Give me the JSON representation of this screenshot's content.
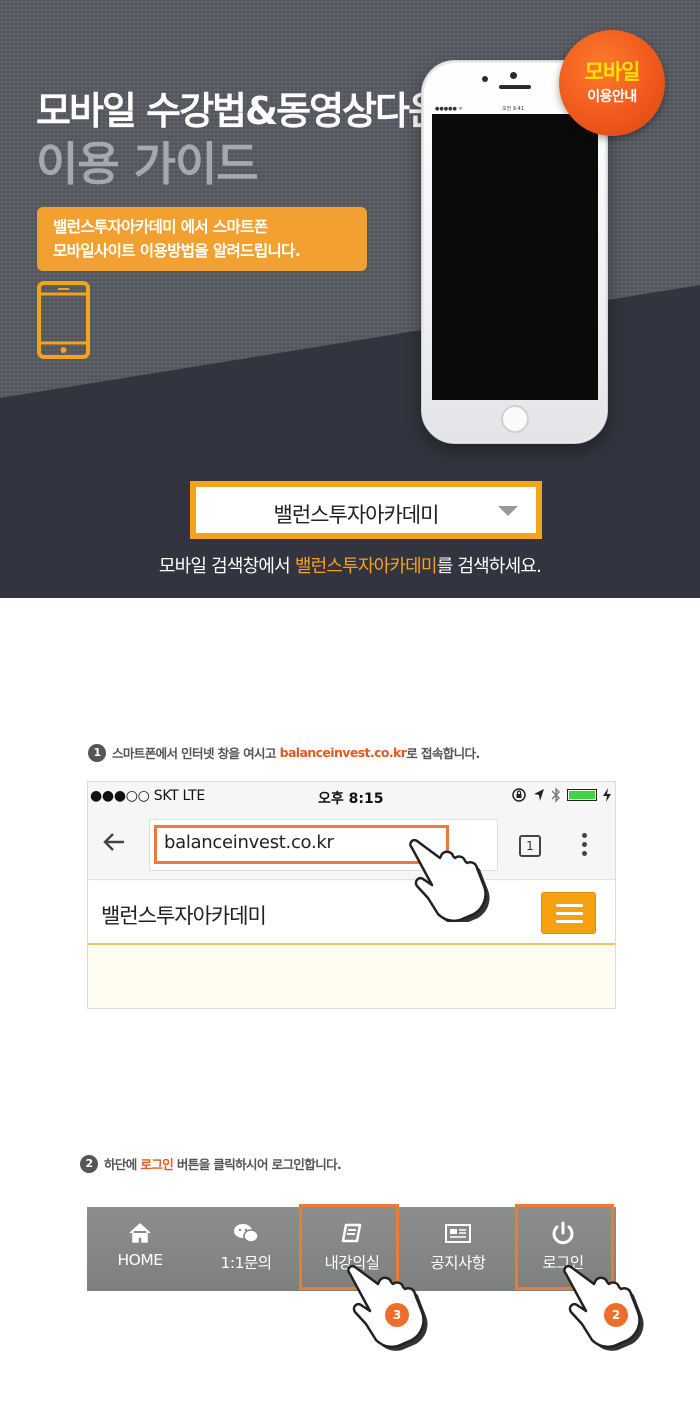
{
  "colors": {
    "accent_orange": "#f5a21d",
    "highlight_orange": "#ee7a36",
    "hero_bg": "#55575f",
    "hero_dark": "#32343f",
    "badge_red": "#ef5a1c",
    "badge_yellow": "#ffe200"
  },
  "hero": {
    "title_line1": "모바일 수강법&동영상다운",
    "title_line2": "이용 가이드",
    "desc_line1": "밸런스투자아카데미 에서 스마트폰",
    "desc_line2": "모바일사이트 이용방법을 알려드립니다.",
    "badge_line1": "모바일",
    "badge_line2": "이용안내",
    "search_value": "밸런스투자아카데미",
    "hint_before": "모바일 검색창에서 ",
    "hint_highlight": "밸런스투자아카데미",
    "hint_after": "를 검색하세요.",
    "icons": [
      "tablet-icon",
      "smartphone-illustration",
      "dropdown-arrow-icon"
    ]
  },
  "step1": {
    "number": "1",
    "text_before": "스마트폰에서 인터넷 창을 여시고 ",
    "text_highlight": "balanceinvest.co.kr",
    "text_after": "로 접속합니다.",
    "status_left": "●●●○○ SKT   LTE",
    "status_time": "오후 8:15",
    "url": "balanceinvest.co.kr",
    "tab_count": "1",
    "site_title": "밸런스투자아카데미",
    "icons": [
      "back-arrow-icon",
      "tabs-icon",
      "more-vert-icon",
      "hamburger-menu-icon",
      "pointing-hand-icon"
    ]
  },
  "step2": {
    "number": "2",
    "text_before": "하단에 ",
    "text_highlight": "로그인",
    "text_after": " 버튼을 클릭하시어 로그인합니다.",
    "nav_items": [
      {
        "label": "HOME",
        "icon": "home-icon"
      },
      {
        "label": "1:1문의",
        "icon": "chat-icon"
      },
      {
        "label": "내강의실",
        "icon": "book-icon"
      },
      {
        "label": "공지사항",
        "icon": "newspaper-icon"
      },
      {
        "label": "로그인",
        "icon": "power-icon"
      }
    ],
    "hand_badges": [
      "3",
      "2"
    ]
  }
}
